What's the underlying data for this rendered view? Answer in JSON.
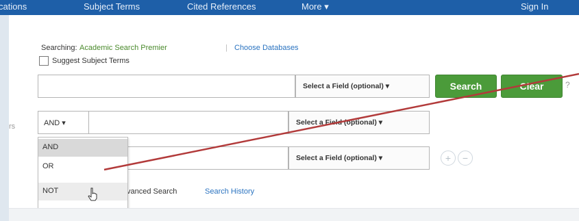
{
  "nav": {
    "items": [
      "cations",
      "Subject Terms",
      "Cited References",
      "More ▾"
    ],
    "sign_in": "Sign In"
  },
  "search": {
    "searching_label": "Searching:",
    "database": "Academic Search Premier",
    "choose_databases": "Choose Databases",
    "suggest_subject_terms": "Suggest Subject Terms",
    "field_placeholder": "Select a Field (optional) ▾",
    "search_button": "Search",
    "clear_button": "Clear",
    "help": "?",
    "boolean_selected": "AND ▾",
    "boolean_options": [
      "AND",
      "OR",
      "NOT"
    ],
    "add_row": "+",
    "remove_row": "−",
    "advanced_search": "vanced Search",
    "search_history": "Search History",
    "left_fragment": "rs"
  },
  "colors": {
    "topbar": "#1e5fa8",
    "accent_green": "#4b9b3a",
    "link_blue": "#2a73c0",
    "annotation_line": "#b23a3a"
  }
}
